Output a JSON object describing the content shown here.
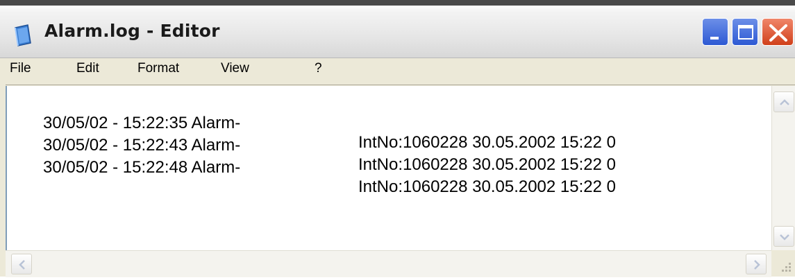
{
  "window": {
    "title": "Alarm.log - Editor",
    "icon": "notepad-icon"
  },
  "menu": {
    "items": [
      {
        "label": "File"
      },
      {
        "label": "Edit"
      },
      {
        "label": "Format"
      },
      {
        "label": "View"
      },
      {
        "label": "?"
      }
    ]
  },
  "document": {
    "lines": [
      {
        "left": "30/05/02 - 15:22:35 Alarm-",
        "right": "IntNo:1060228 30.05.2002 15:22 0"
      },
      {
        "left": "30/05/02 - 15:22:43 Alarm-",
        "right": "IntNo:1060228 30.05.2002 15:22 0"
      },
      {
        "left": "30/05/02 - 15:22:48 Alarm-",
        "right": "IntNo:1060228 30.05.2002 15:22 0"
      }
    ]
  },
  "colors": {
    "titlebar": "#e6e6e6",
    "control_blue": "#2d59d3",
    "close_red": "#d0401b",
    "menubar": "#ece9d8",
    "editor_bg": "#ffffff"
  }
}
